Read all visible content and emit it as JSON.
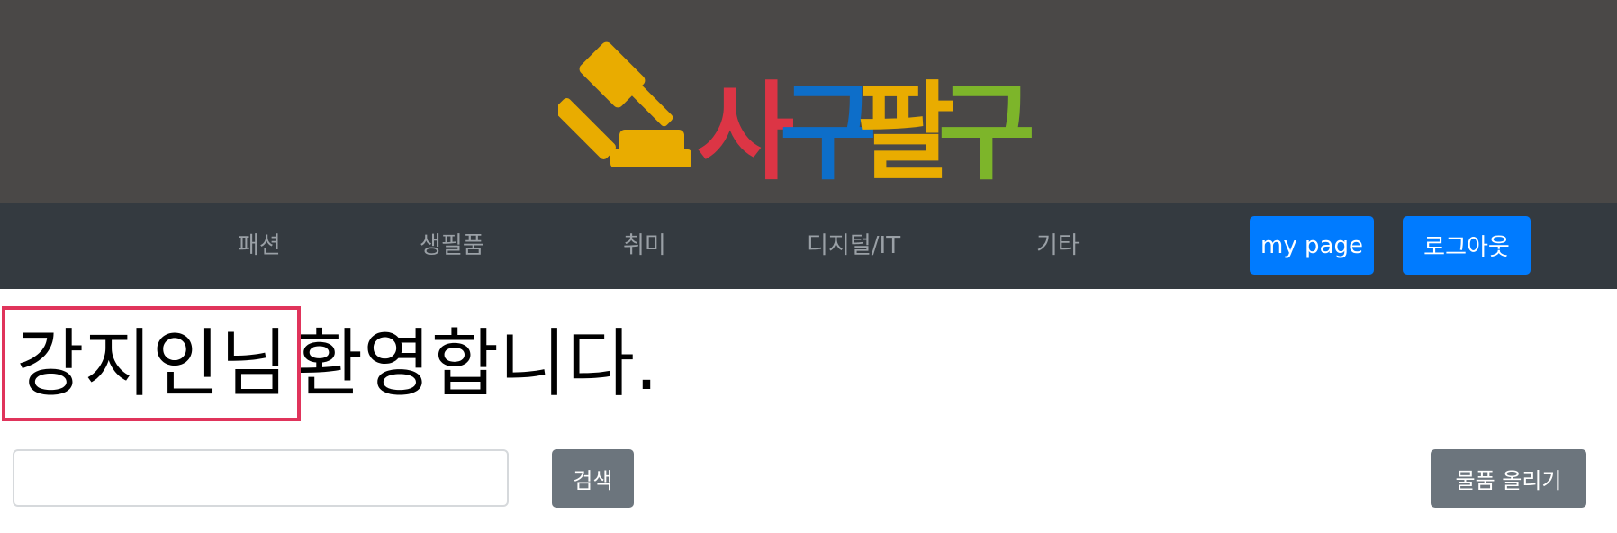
{
  "logo": {
    "text": "사구팔구",
    "syllables": [
      {
        "text": "사",
        "color": "#dc3545"
      },
      {
        "text": "구",
        "color": "#0d6ec9"
      },
      {
        "text": "팔",
        "color": "#e9ac00"
      },
      {
        "text": "구",
        "color": "#7db52a"
      }
    ],
    "gavel_color": "#e9ac00"
  },
  "nav": {
    "items": [
      "패션",
      "생필품",
      "취미",
      "디지털/IT",
      "기타"
    ],
    "mypage_label": "my page",
    "logout_label": "로그아웃"
  },
  "welcome": {
    "username": "강지인님",
    "message": "환영합니다."
  },
  "search": {
    "value": "",
    "placeholder": "",
    "button_label": "검색"
  },
  "upload": {
    "button_label": "물품 올리기"
  },
  "colors": {
    "banner": "#4a4847",
    "navbar": "#343a40",
    "primary": "#007bff",
    "secondary": "#6c757d",
    "highlight": "#e0345b"
  }
}
